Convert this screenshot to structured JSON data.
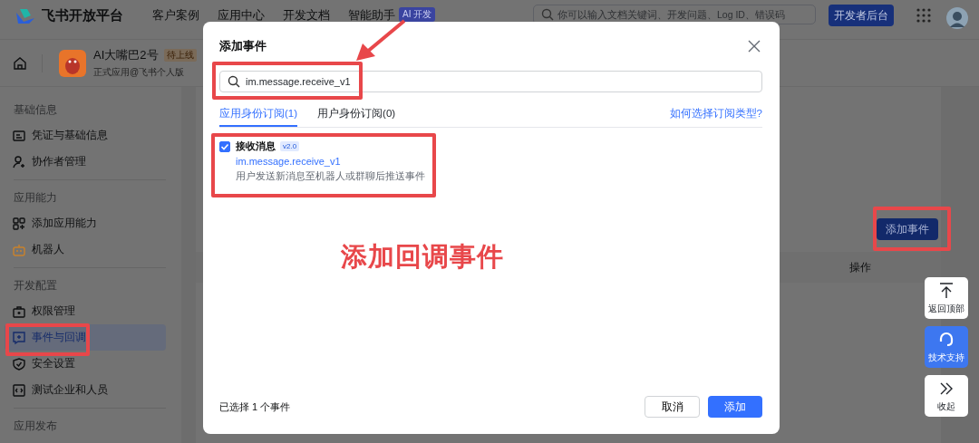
{
  "top_nav": {
    "brand": "飞书开放平台",
    "links": [
      "客户案例",
      "应用中心",
      "开发文档",
      "智能助手"
    ],
    "ai_badge": "AI 开发",
    "search": {
      "placeholder": "你可以输入文档关键词、开发问题、Log ID、错误码"
    },
    "console_button": "开发者后台"
  },
  "app_header": {
    "name": "AI大嘴巴2号",
    "status": "待上线",
    "subtitle": "正式应用@飞书个人版"
  },
  "sidebar": {
    "groups": [
      {
        "title": "基础信息",
        "items": [
          {
            "label": "凭证与基础信息",
            "selected": false
          },
          {
            "label": "协作者管理",
            "selected": false
          }
        ]
      },
      {
        "title": "应用能力",
        "items": [
          {
            "label": "添加应用能力",
            "selected": false
          },
          {
            "label": "机器人",
            "selected": false
          }
        ]
      },
      {
        "title": "开发配置",
        "items": [
          {
            "label": "权限管理",
            "selected": false
          },
          {
            "label": "事件与回调",
            "selected": true
          },
          {
            "label": "安全设置",
            "selected": false
          },
          {
            "label": "测试企业和人员",
            "selected": false
          }
        ]
      },
      {
        "title": "应用发布"
      }
    ]
  },
  "main": {
    "add_event_button": "添加事件",
    "table": {
      "columns": [
        "操作"
      ]
    }
  },
  "modal": {
    "title": "添加事件",
    "search": {
      "value": "im.message.receive_v1"
    },
    "tabs": [
      {
        "label": "应用身份订阅(1)",
        "selected": true
      },
      {
        "label": "用户身份订阅(0)",
        "selected": false
      }
    ],
    "help_link": "如何选择订阅类型?",
    "events": [
      {
        "name": "接收消息",
        "version": "v2.0",
        "key": "im.message.receive_v1",
        "description": "用户发送新消息至机器人或群聊后推送事件",
        "checked": true
      }
    ],
    "selection_summary": "已选择 1 个事件",
    "cancel_button": "取消",
    "confirm_button": "添加"
  },
  "float_buttons": [
    {
      "kind": "top",
      "label": "返回顶部"
    },
    {
      "kind": "support",
      "label": "技术支持"
    },
    {
      "kind": "collapse",
      "label": "收起"
    }
  ],
  "annotation": {
    "caption": "添加回调事件"
  }
}
